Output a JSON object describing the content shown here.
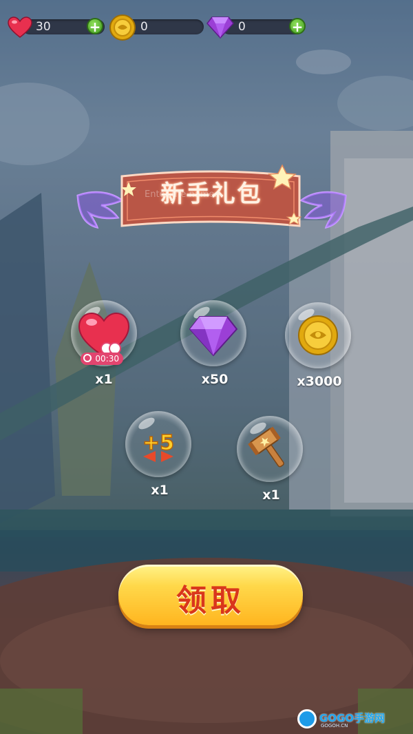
{
  "resources": [
    {
      "name": "lives",
      "icon": "heart-icon",
      "value": "30",
      "has_plus": true
    },
    {
      "name": "coins",
      "icon": "coin-icon",
      "value": "0",
      "has_plus": false
    },
    {
      "name": "gems",
      "icon": "diamond-icon",
      "value": "0",
      "has_plus": true
    }
  ],
  "title": "新手礼包",
  "ghost_text": "Enter the name...",
  "rewards": [
    {
      "item": "heart-with-timer",
      "icon": "heart-icon",
      "timer": "00:30",
      "count": "x1"
    },
    {
      "item": "diamond",
      "icon": "diamond-icon",
      "count": "x50"
    },
    {
      "item": "coin",
      "icon": "coin-icon",
      "count": "x3000"
    },
    {
      "item": "plus-5-moves",
      "icon": "plus-five-moves-icon",
      "label": "+5",
      "count": "x1"
    },
    {
      "item": "hammer",
      "icon": "hammer-icon",
      "count": "x1"
    }
  ],
  "claim_button": "领取",
  "watermark": {
    "text": "GOGO手游网",
    "sub": "GOGOH.CN"
  },
  "colors": {
    "accent": "#ffb51f",
    "button_text": "#d9361c",
    "banner": "#c8503a",
    "neon": "#b77cff"
  }
}
